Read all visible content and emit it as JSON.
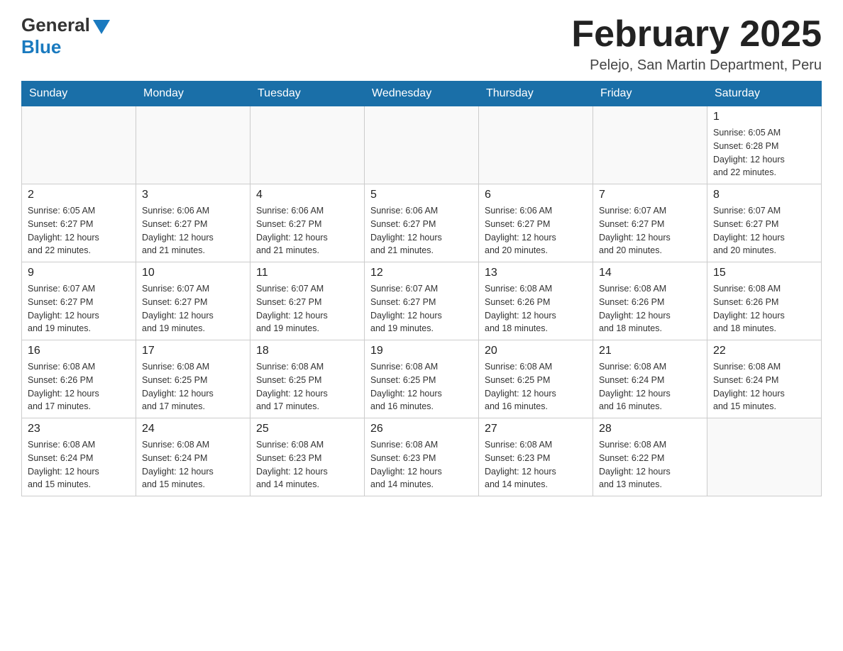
{
  "header": {
    "logo_general": "General",
    "logo_blue": "Blue",
    "month_title": "February 2025",
    "location": "Pelejo, San Martin Department, Peru"
  },
  "weekdays": [
    "Sunday",
    "Monday",
    "Tuesday",
    "Wednesday",
    "Thursday",
    "Friday",
    "Saturday"
  ],
  "weeks": [
    [
      {
        "day": "",
        "info": ""
      },
      {
        "day": "",
        "info": ""
      },
      {
        "day": "",
        "info": ""
      },
      {
        "day": "",
        "info": ""
      },
      {
        "day": "",
        "info": ""
      },
      {
        "day": "",
        "info": ""
      },
      {
        "day": "1",
        "info": "Sunrise: 6:05 AM\nSunset: 6:28 PM\nDaylight: 12 hours\nand 22 minutes."
      }
    ],
    [
      {
        "day": "2",
        "info": "Sunrise: 6:05 AM\nSunset: 6:27 PM\nDaylight: 12 hours\nand 22 minutes."
      },
      {
        "day": "3",
        "info": "Sunrise: 6:06 AM\nSunset: 6:27 PM\nDaylight: 12 hours\nand 21 minutes."
      },
      {
        "day": "4",
        "info": "Sunrise: 6:06 AM\nSunset: 6:27 PM\nDaylight: 12 hours\nand 21 minutes."
      },
      {
        "day": "5",
        "info": "Sunrise: 6:06 AM\nSunset: 6:27 PM\nDaylight: 12 hours\nand 21 minutes."
      },
      {
        "day": "6",
        "info": "Sunrise: 6:06 AM\nSunset: 6:27 PM\nDaylight: 12 hours\nand 20 minutes."
      },
      {
        "day": "7",
        "info": "Sunrise: 6:07 AM\nSunset: 6:27 PM\nDaylight: 12 hours\nand 20 minutes."
      },
      {
        "day": "8",
        "info": "Sunrise: 6:07 AM\nSunset: 6:27 PM\nDaylight: 12 hours\nand 20 minutes."
      }
    ],
    [
      {
        "day": "9",
        "info": "Sunrise: 6:07 AM\nSunset: 6:27 PM\nDaylight: 12 hours\nand 19 minutes."
      },
      {
        "day": "10",
        "info": "Sunrise: 6:07 AM\nSunset: 6:27 PM\nDaylight: 12 hours\nand 19 minutes."
      },
      {
        "day": "11",
        "info": "Sunrise: 6:07 AM\nSunset: 6:27 PM\nDaylight: 12 hours\nand 19 minutes."
      },
      {
        "day": "12",
        "info": "Sunrise: 6:07 AM\nSunset: 6:27 PM\nDaylight: 12 hours\nand 19 minutes."
      },
      {
        "day": "13",
        "info": "Sunrise: 6:08 AM\nSunset: 6:26 PM\nDaylight: 12 hours\nand 18 minutes."
      },
      {
        "day": "14",
        "info": "Sunrise: 6:08 AM\nSunset: 6:26 PM\nDaylight: 12 hours\nand 18 minutes."
      },
      {
        "day": "15",
        "info": "Sunrise: 6:08 AM\nSunset: 6:26 PM\nDaylight: 12 hours\nand 18 minutes."
      }
    ],
    [
      {
        "day": "16",
        "info": "Sunrise: 6:08 AM\nSunset: 6:26 PM\nDaylight: 12 hours\nand 17 minutes."
      },
      {
        "day": "17",
        "info": "Sunrise: 6:08 AM\nSunset: 6:25 PM\nDaylight: 12 hours\nand 17 minutes."
      },
      {
        "day": "18",
        "info": "Sunrise: 6:08 AM\nSunset: 6:25 PM\nDaylight: 12 hours\nand 17 minutes."
      },
      {
        "day": "19",
        "info": "Sunrise: 6:08 AM\nSunset: 6:25 PM\nDaylight: 12 hours\nand 16 minutes."
      },
      {
        "day": "20",
        "info": "Sunrise: 6:08 AM\nSunset: 6:25 PM\nDaylight: 12 hours\nand 16 minutes."
      },
      {
        "day": "21",
        "info": "Sunrise: 6:08 AM\nSunset: 6:24 PM\nDaylight: 12 hours\nand 16 minutes."
      },
      {
        "day": "22",
        "info": "Sunrise: 6:08 AM\nSunset: 6:24 PM\nDaylight: 12 hours\nand 15 minutes."
      }
    ],
    [
      {
        "day": "23",
        "info": "Sunrise: 6:08 AM\nSunset: 6:24 PM\nDaylight: 12 hours\nand 15 minutes."
      },
      {
        "day": "24",
        "info": "Sunrise: 6:08 AM\nSunset: 6:24 PM\nDaylight: 12 hours\nand 15 minutes."
      },
      {
        "day": "25",
        "info": "Sunrise: 6:08 AM\nSunset: 6:23 PM\nDaylight: 12 hours\nand 14 minutes."
      },
      {
        "day": "26",
        "info": "Sunrise: 6:08 AM\nSunset: 6:23 PM\nDaylight: 12 hours\nand 14 minutes."
      },
      {
        "day": "27",
        "info": "Sunrise: 6:08 AM\nSunset: 6:23 PM\nDaylight: 12 hours\nand 14 minutes."
      },
      {
        "day": "28",
        "info": "Sunrise: 6:08 AM\nSunset: 6:22 PM\nDaylight: 12 hours\nand 13 minutes."
      },
      {
        "day": "",
        "info": ""
      }
    ]
  ]
}
